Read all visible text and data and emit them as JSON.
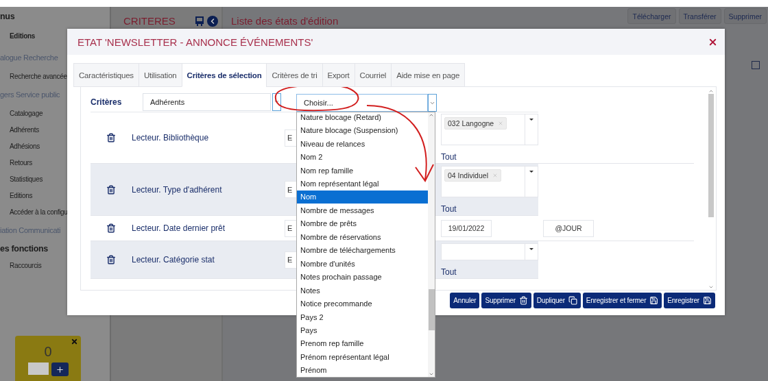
{
  "sidebar": {
    "items": [
      {
        "label": "nus",
        "kind": "heading"
      },
      {
        "label": "Editions",
        "kind": "bold"
      },
      {
        "label": "alogue Recherche",
        "kind": "section"
      },
      {
        "label": "Recherche avancée",
        "kind": "item"
      },
      {
        "label": "gers Service public",
        "kind": "section"
      },
      {
        "label": "Catalogage",
        "kind": "item"
      },
      {
        "label": "Adhérents",
        "kind": "item"
      },
      {
        "label": "Adhésions",
        "kind": "item"
      },
      {
        "label": "Retours",
        "kind": "item"
      },
      {
        "label": "Statistiques",
        "kind": "item"
      },
      {
        "label": "Editions",
        "kind": "item"
      },
      {
        "label": "Accéder à la configu",
        "kind": "item"
      },
      {
        "label": "iation Communicati",
        "kind": "section"
      },
      {
        "label": "es fonctions",
        "kind": "heading"
      },
      {
        "label": "Raccourcis",
        "kind": "item"
      }
    ]
  },
  "counter_widget": {
    "value": "0"
  },
  "criteria_column": {
    "title": "CRITERES"
  },
  "main": {
    "title": "Liste des états d'édition",
    "actions": [
      "Télécharger",
      "Transférer",
      "Supprimer"
    ],
    "checkbox": {
      "checked": false
    }
  },
  "dialog": {
    "title": "ETAT 'NEWSLETTER - ANNONCE ÉVÉNEMENTS'",
    "tabs": [
      {
        "label": "Caractéristiques",
        "selected": false
      },
      {
        "label": "Utilisation",
        "selected": false
      },
      {
        "label": "Critères de sélection",
        "selected": true
      },
      {
        "label": "Critères de tri",
        "selected": false
      },
      {
        "label": "Export",
        "selected": false
      },
      {
        "label": "Courriel",
        "selected": false
      },
      {
        "label": "Aide mise en page",
        "selected": false
      }
    ],
    "criteria_label": "Critères",
    "category_select": "Adhérents",
    "field_select": {
      "placeholder": "Choisir..."
    },
    "rows": [
      {
        "label": "Lecteur. Bibliothèque",
        "operator": "E",
        "kind": "multiselect",
        "tags": [
          "032 Langogne"
        ],
        "link": "Tout"
      },
      {
        "label": "Lecteur. Type d'adhérent",
        "operator": "E",
        "kind": "multiselect",
        "tags": [
          "04 Individuel"
        ],
        "link": "Tout"
      },
      {
        "label": "Lecteur. Date dernier prêt",
        "operator": "E",
        "kind": "date",
        "value": "19/01/2022",
        "value_2": "@JOUR"
      },
      {
        "label": "Lecteur. Catégorie stat",
        "operator": "E",
        "kind": "multiselect",
        "link": "Tout"
      }
    ],
    "buttons": [
      {
        "label": "Annuler",
        "kind": "plain"
      },
      {
        "label": "Supprimer",
        "kind": "trash"
      },
      {
        "label": "Dupliquer",
        "kind": "copy"
      },
      {
        "label": "Enregistrer et fermer",
        "kind": "save"
      },
      {
        "label": "Enregistrer",
        "kind": "save"
      }
    ]
  },
  "dropdown": {
    "options": [
      {
        "label": "Nature blocage (Retard)",
        "selected": false
      },
      {
        "label": "Nature blocage (Suspension)",
        "selected": false
      },
      {
        "label": "Niveau de relances",
        "selected": false
      },
      {
        "label": "Nom 2",
        "selected": false
      },
      {
        "label": "Nom rep famille",
        "selected": false
      },
      {
        "label": "Nom représentant légal",
        "selected": false
      },
      {
        "label": "Nom",
        "selected": true
      },
      {
        "label": "Nombre de messages",
        "selected": false
      },
      {
        "label": "Nombre de prêts",
        "selected": false
      },
      {
        "label": "Nombre de réservations",
        "selected": false
      },
      {
        "label": "Nombre de téléchargements",
        "selected": false
      },
      {
        "label": "Nombre d'unités",
        "selected": false
      },
      {
        "label": "Notes prochain passage",
        "selected": false
      },
      {
        "label": "Notes",
        "selected": false
      },
      {
        "label": "Notice precommande",
        "selected": false
      },
      {
        "label": "Pays 2",
        "selected": false
      },
      {
        "label": "Pays",
        "selected": false
      },
      {
        "label": "Prenom rep famille",
        "selected": false
      },
      {
        "label": "Prénom représentant légal",
        "selected": false
      },
      {
        "label": "Prénom",
        "selected": false
      }
    ]
  }
}
